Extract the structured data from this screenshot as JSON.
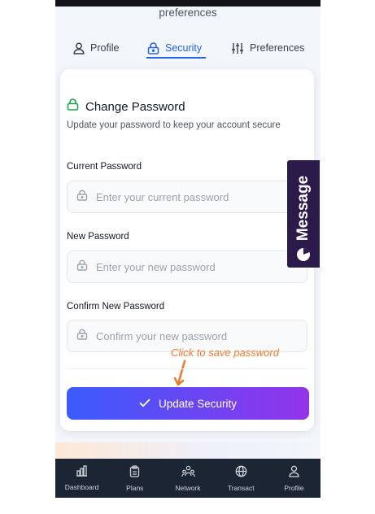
{
  "page": {
    "subtitle": "preferences"
  },
  "tabs": [
    {
      "label": "Profile",
      "icon": "user-icon",
      "active": false
    },
    {
      "label": "Security",
      "icon": "lock-icon",
      "active": true
    },
    {
      "label": "Preferences",
      "icon": "sliders-icon",
      "active": false
    }
  ],
  "card": {
    "title": "Change Password",
    "title_icon": "lock-icon",
    "description": "Update your password to keep your account secure",
    "fields": [
      {
        "label": "Current Password",
        "placeholder": "Enter your current password",
        "value": ""
      },
      {
        "label": "New Password",
        "placeholder": "Enter your new password",
        "value": ""
      },
      {
        "label": "Confirm New Password",
        "placeholder": "Confirm your new password",
        "value": ""
      }
    ],
    "annotation": "Click to save password",
    "submit_label": "Update Security",
    "submit_icon": "check-icon"
  },
  "side_tab": {
    "label": "Message",
    "icon": "chat-bubble-icon"
  },
  "bottom_nav": [
    {
      "label": "Dashboard",
      "icon": "chart-icon"
    },
    {
      "label": "Plans",
      "icon": "clipboard-icon"
    },
    {
      "label": "Network",
      "icon": "users-icon"
    },
    {
      "label": "Transact",
      "icon": "globe-icon"
    },
    {
      "label": "Profile",
      "icon": "user-icon"
    }
  ],
  "colors": {
    "accent": "#2563eb",
    "button_gradient_start": "#3b5bfd",
    "button_gradient_end": "#9333ea",
    "annotation": "#f0782c",
    "nav_background": "#1b2533",
    "message_tab": "#2c1a4b",
    "success_icon": "#16a34a"
  }
}
